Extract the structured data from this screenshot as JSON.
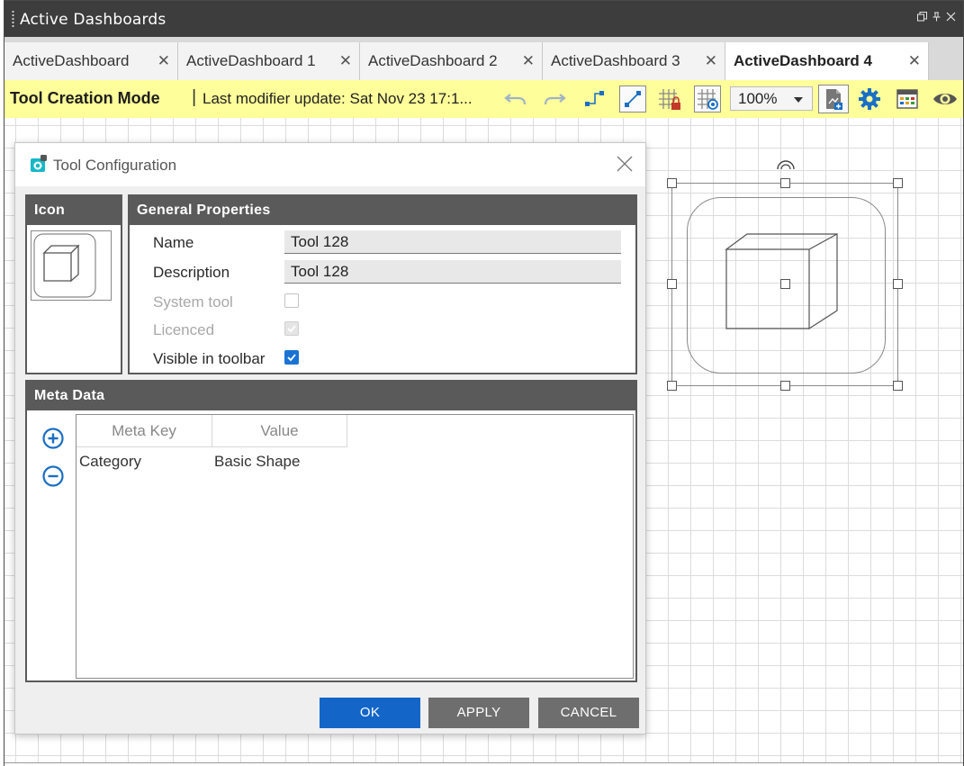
{
  "window": {
    "title": "Active Dashboards",
    "controls": [
      "restore-icon",
      "pin-icon",
      "close-icon"
    ]
  },
  "tabs": [
    {
      "label": "ActiveDashboard",
      "active": false
    },
    {
      "label": "ActiveDashboard 1",
      "active": false
    },
    {
      "label": "ActiveDashboard 2",
      "active": false
    },
    {
      "label": "ActiveDashboard 3",
      "active": false
    },
    {
      "label": "ActiveDashboard 4",
      "active": true
    }
  ],
  "tab_close_glyph": "✕",
  "toolbar": {
    "mode": "Tool Creation Mode",
    "separator": "|",
    "last_update": "Last modifier update: Sat Nov 23 17:1...",
    "zoom": "100%",
    "icons": [
      "undo-icon",
      "redo-icon",
      "connector-icon",
      "line-tool-icon",
      "grid-lock-icon",
      "grid-view-icon",
      "export-icon",
      "settings-icon",
      "calendar-icon",
      "preview-icon"
    ]
  },
  "dialog": {
    "title": "Tool Configuration",
    "icon_panel": {
      "header": "Icon"
    },
    "general": {
      "header": "General Properties",
      "name_label": "Name",
      "name_value": "Tool 128",
      "description_label": "Description",
      "description_value": "Tool 128",
      "system_tool_label": "System tool",
      "system_tool_checked": false,
      "licenced_label": "Licenced",
      "licenced_checked": true,
      "visible_label": "Visible in toolbar",
      "visible_checked": true
    },
    "meta": {
      "header": "Meta Data",
      "columns": [
        "Meta Key",
        "Value"
      ],
      "rows": [
        {
          "key": "Category",
          "value": "Basic Shape"
        }
      ]
    },
    "buttons": {
      "ok": "OK",
      "apply": "APPLY",
      "cancel": "CANCEL"
    }
  },
  "colors": {
    "titlebar": "#3d3d3d",
    "toolbar_bg": "#fefe9a",
    "accent_blue": "#1366c8",
    "panel_header": "#5a5a5a",
    "settings_icon": "#1a6fc4"
  }
}
